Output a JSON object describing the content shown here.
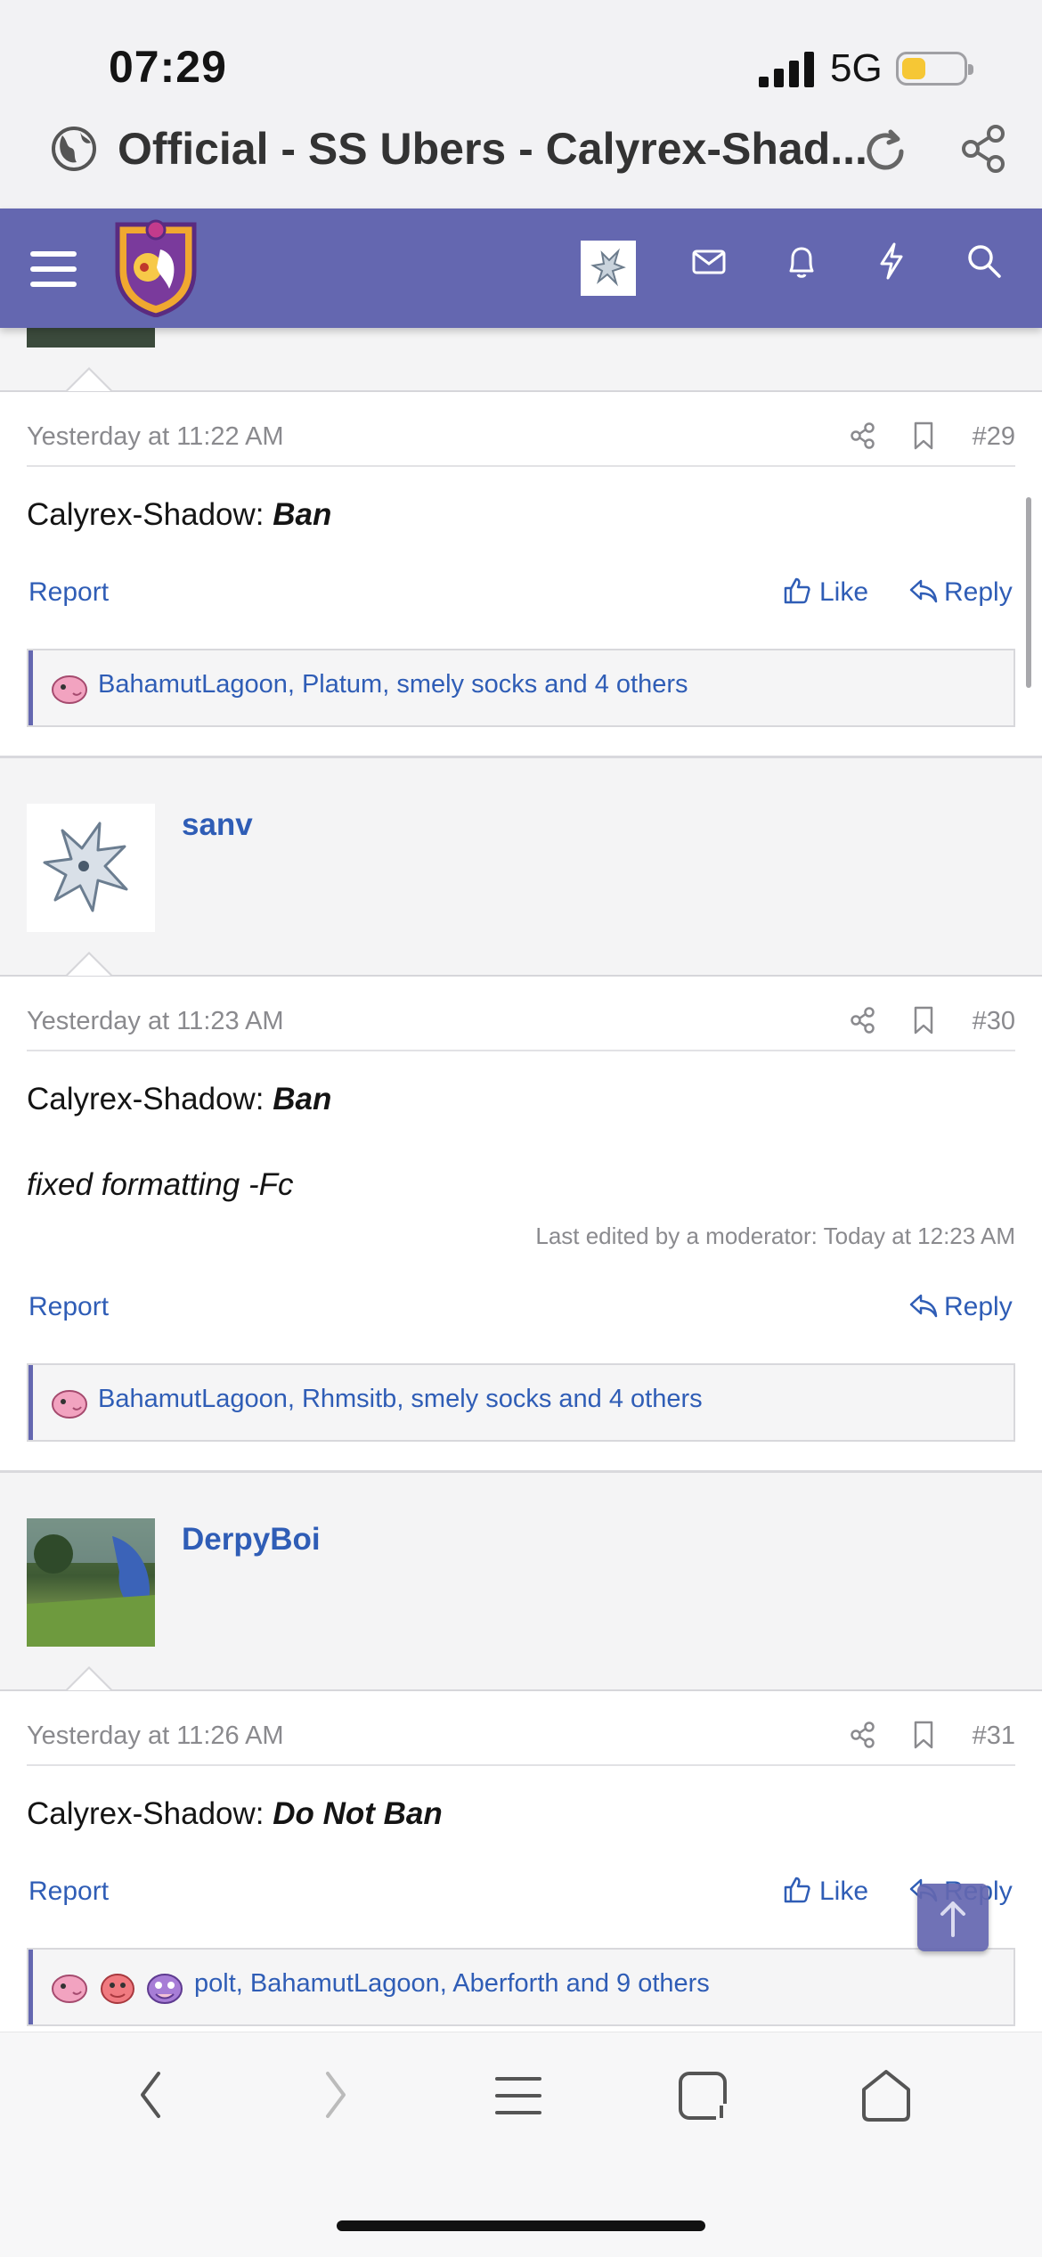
{
  "status_bar": {
    "time": "07:29",
    "network": "5G",
    "battery_fill": 0.4,
    "battery_color": "#f6c735"
  },
  "browser": {
    "page_title": "Official - SS Ubers - Calyrex-Shad..."
  },
  "forum": {
    "header_color": "#6467b0",
    "link_color": "#2f5db6"
  },
  "posts": [
    {
      "timestamp": "Yesterday at 11:22 AM",
      "number": "#29",
      "vote_label": "Calyrex-Shadow:",
      "vote_value": "Ban",
      "report_label": "Report",
      "like_label": "Like",
      "reply_label": "Reply",
      "likes_text": "BahamutLagoon, Platum, smely socks and 4 others"
    },
    {
      "username": "sanv",
      "timestamp": "Yesterday at 11:23 AM",
      "number": "#30",
      "vote_label": "Calyrex-Shadow:",
      "vote_value": "Ban",
      "note": "fixed formatting -Fc",
      "edited": "Last edited by a moderator: Today at 12:23 AM",
      "report_label": "Report",
      "reply_label": "Reply",
      "likes_text": "BahamutLagoon, Rhmsitb, smely socks and 4 others"
    },
    {
      "username": "DerpyBoi",
      "timestamp": "Yesterday at 11:26 AM",
      "number": "#31",
      "vote_label": "Calyrex-Shadow:",
      "vote_value": "Do Not Ban",
      "report_label": "Report",
      "like_label": "Like",
      "reply_label": "Reply",
      "likes_text": "polt, BahamutLagoon, Aberforth and 9 others"
    }
  ]
}
